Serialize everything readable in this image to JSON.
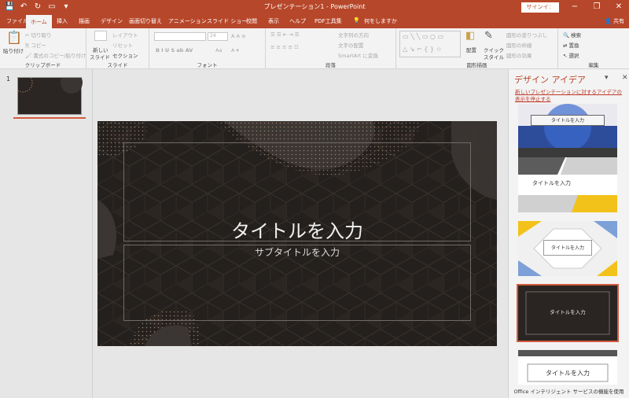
{
  "window": {
    "title": "プレゼンテーション1 - PowerPoint",
    "signin": "サインイン"
  },
  "qat": {
    "save": "💾",
    "undo": "↶",
    "redo": "↻",
    "present": "▭",
    "more": "▾"
  },
  "tabs": [
    {
      "label": "ファイル"
    },
    {
      "label": "ホーム"
    },
    {
      "label": "挿入"
    },
    {
      "label": "描画"
    },
    {
      "label": "デザイン"
    },
    {
      "label": "画面切り替え"
    },
    {
      "label": "アニメーション"
    },
    {
      "label": "スライド ショー"
    },
    {
      "label": "校閲"
    },
    {
      "label": "表示"
    },
    {
      "label": "ヘルプ"
    },
    {
      "label": "PDF工具集"
    },
    {
      "label": "何をしますか"
    }
  ],
  "share": "共有",
  "ribbon": {
    "clipboard": {
      "paste": "貼り付け",
      "cut": "切り取り",
      "copy": "コピー",
      "format_painter": "書式のコピー/貼り付け",
      "label": "クリップボード"
    },
    "slides": {
      "new_slide": "新しい",
      "new_slide2": "スライド",
      "layout": "レイアウト",
      "reset": "リセット",
      "section": "セクション",
      "label": "スライド"
    },
    "font": {
      "size": "24",
      "label": "フォント",
      "aa": "Aa"
    },
    "paragraph": {
      "text_direction": "文字列の方向",
      "align_text": "文字の配置",
      "smartart": "SmartArt に変換",
      "label": "段落"
    },
    "drawing": {
      "arrange": "配置",
      "quick_styles": "クイック",
      "quick_styles2": "スタイル",
      "fill": "図形の塗りつぶし",
      "outline": "図形の枠線",
      "effects": "図形の効果",
      "label": "図形描画"
    },
    "editing": {
      "find": "検索",
      "replace": "置換",
      "select": "選択",
      "label": "編集"
    }
  },
  "slide_panel": {
    "number": "1"
  },
  "slide": {
    "title": "タイトルを入力",
    "subtitle": "サブタイトルを入力"
  },
  "design_pane": {
    "title": "デザイン アイデア",
    "stop_link": "新しいプレゼンテーションに対するアイデアの表示を停止する",
    "cards": [
      {
        "title": "タイトルを入力"
      },
      {
        "title": "タイトルを入力"
      },
      {
        "title": "タイトルを入力"
      },
      {
        "title": "タイトルを入力"
      },
      {
        "title": "タイトルを入力"
      }
    ],
    "footer": "Office インテリジェント サービスの機能を使用"
  },
  "colors": {
    "accent": "#b7472a",
    "slide_bg": "#24201d",
    "selection": "#d35b3e"
  }
}
